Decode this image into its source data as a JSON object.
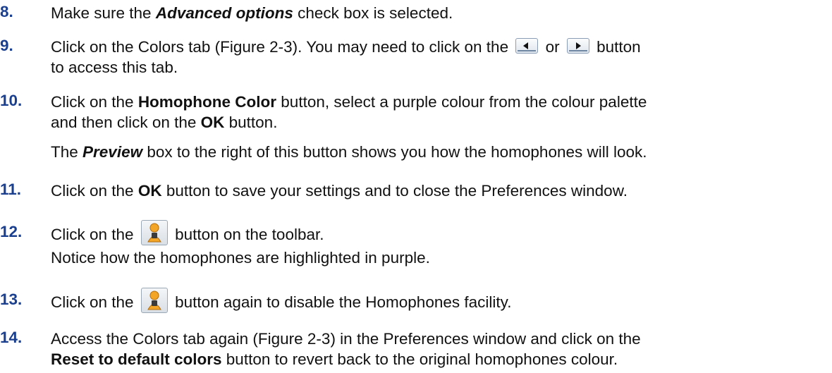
{
  "steps": [
    {
      "number": "8.",
      "parts": {
        "a": "Make sure the ",
        "b": "Advanced options",
        "c": " check box is selected."
      }
    },
    {
      "number": "9.",
      "line1": {
        "a": "Click on the Colors tab (Figure 2-3). You may need to click on the ",
        "b": " or ",
        "c": " button"
      },
      "line2": "to access this tab.",
      "icons": [
        "left-arrow-icon",
        "right-arrow-icon"
      ]
    },
    {
      "number": "10.",
      "line1": {
        "a": "Click on the ",
        "b": "Homophone Color",
        "c": " button, select a purple colour from the colour palette"
      },
      "line2": {
        "a": "and then click on the ",
        "b": "OK",
        "c": " button."
      },
      "note": {
        "a": "The ",
        "b": "Preview",
        "c": " box to the right of this button shows you how the homophones will look."
      }
    },
    {
      "number": "11.",
      "parts": {
        "a": "Click on the ",
        "b": "OK",
        "c": " button to save your settings and to close the Preferences window."
      }
    },
    {
      "number": "12.",
      "line1": {
        "a": "Click on the ",
        "b": " button on the toolbar."
      },
      "line2": "Notice how the homophones are highlighted in purple.",
      "icon": "homophones-icon"
    },
    {
      "number": "13.",
      "line1": {
        "a": "Click on the ",
        "b": " button again to disable the Homophones facility."
      },
      "icon": "homophones-icon"
    },
    {
      "number": "14.",
      "line1": "Access the Colors tab again (Figure 2-3) in the Preferences window and click on the",
      "line2": {
        "a": "Reset to default colors",
        "b": " button to revert back to the original homophones colour."
      }
    }
  ],
  "colors": {
    "step_number": "#1b3f8f",
    "text": "#111111",
    "icon_border": "#8a9db5"
  }
}
